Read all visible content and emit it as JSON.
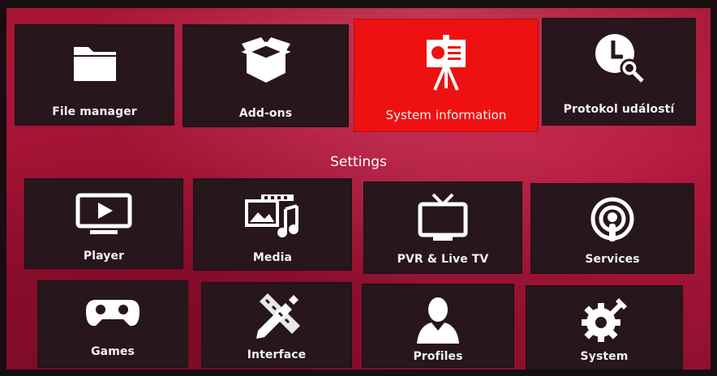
{
  "top_row": [
    {
      "label": "File manager",
      "icon": "folder-icon"
    },
    {
      "label": "Add-ons",
      "icon": "box-icon"
    },
    {
      "label": "System information",
      "icon": "presentation-board-icon",
      "selected": true
    },
    {
      "label": "Protokol událostí",
      "icon": "clock-search-icon"
    }
  ],
  "settings": {
    "title": "Settings",
    "items": [
      {
        "label": "Player",
        "icon": "player-screen-icon"
      },
      {
        "label": "Media",
        "icon": "media-film-music-icon"
      },
      {
        "label": "PVR & Live TV",
        "icon": "tv-antenna-icon"
      },
      {
        "label": "Services",
        "icon": "podcast-broadcast-icon"
      },
      {
        "label": "Games",
        "icon": "gamepad-icon"
      },
      {
        "label": "Interface",
        "icon": "pencil-ruler-icon"
      },
      {
        "label": "Profiles",
        "icon": "user-profile-icon"
      },
      {
        "label": "System",
        "icon": "gear-wrench-icon"
      }
    ]
  },
  "colors": {
    "background": "#b3173d",
    "tile": "#27161b",
    "selected_tile": "#ef1111",
    "text": "#ffffff"
  }
}
